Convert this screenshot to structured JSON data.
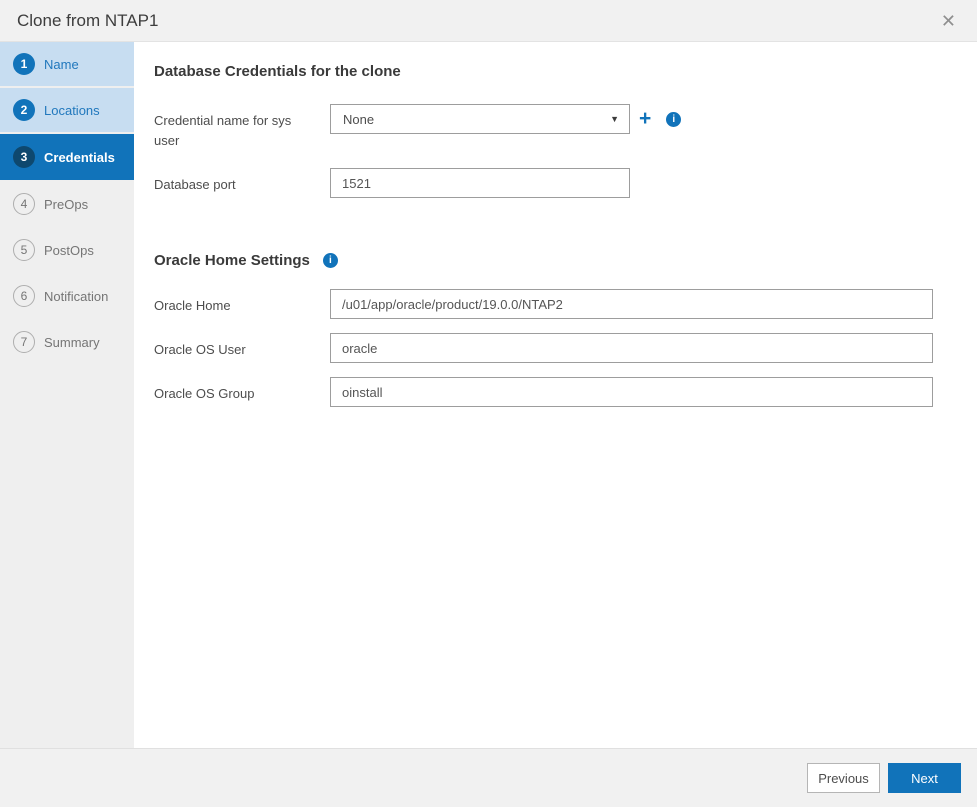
{
  "header": {
    "title": "Clone from NTAP1"
  },
  "sidebar": {
    "steps": [
      {
        "number": "1",
        "label": "Name",
        "state": "done"
      },
      {
        "number": "2",
        "label": "Locations",
        "state": "done"
      },
      {
        "number": "3",
        "label": "Credentials",
        "state": "active"
      },
      {
        "number": "4",
        "label": "PreOps",
        "state": "pending"
      },
      {
        "number": "5",
        "label": "PostOps",
        "state": "pending"
      },
      {
        "number": "6",
        "label": "Notification",
        "state": "pending"
      },
      {
        "number": "7",
        "label": "Summary",
        "state": "pending"
      }
    ]
  },
  "content": {
    "sections": [
      {
        "title": "Database Credentials for the clone",
        "fields": [
          {
            "label": "Credential name for sys user",
            "type": "select",
            "value": "None"
          },
          {
            "label": "Database port",
            "type": "text",
            "value": "1521"
          }
        ]
      },
      {
        "title": "Oracle Home Settings",
        "fields": [
          {
            "label": "Oracle Home",
            "type": "text",
            "value": "/u01/app/oracle/product/19.0.0/NTAP2"
          },
          {
            "label": "Oracle OS User",
            "type": "text",
            "value": "oracle"
          },
          {
            "label": "Oracle OS Group",
            "type": "text",
            "value": "oinstall"
          }
        ]
      }
    ]
  },
  "icons": {
    "close": "✕",
    "dropdown_caret": "▼",
    "add": "+",
    "info": "i"
  },
  "footer": {
    "previous_label": "Previous",
    "next_label": "Next"
  },
  "colors": {
    "accent_blue": "#1173ba",
    "active_step_circle": "#0e486e",
    "done_step_bg": "#c7ddf1",
    "done_step_text": "#2178bd",
    "pending_step_bg": "#efefef",
    "titlebar_bg": "#f1f1f1",
    "footer_bg": "#f1f1f1",
    "input_border": "#9d9d9d"
  }
}
